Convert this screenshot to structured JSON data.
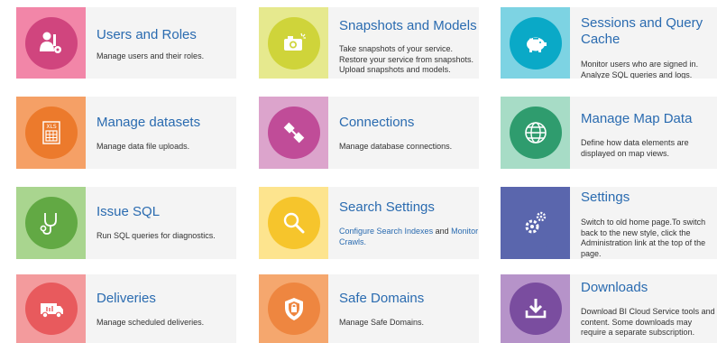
{
  "cards": [
    {
      "title": "Users and Roles",
      "desc": "Manage users and their roles.",
      "icon": "users-roles-icon",
      "tile": "#f286a8",
      "circle": "#d0457e"
    },
    {
      "title": "Snapshots and Models",
      "desc": "Take snapshots of your service. Restore your service from snapshots. Upload snapshots and models.",
      "icon": "camera-icon",
      "tile": "#e6e98e",
      "circle": "#cfd43a"
    },
    {
      "title": "Sessions and Query Cache",
      "desc": "Monitor users who are signed in. Analyze SQL queries and logs.",
      "icon": "piggy-bank-icon",
      "tile": "#7dd3e3",
      "circle": "#0aa9c7"
    },
    {
      "title": "Manage datasets",
      "desc": "Manage data file uploads.",
      "icon": "xls-file-icon",
      "tile": "#f5a066",
      "circle": "#ec7a2c"
    },
    {
      "title": "Connections",
      "desc": "Manage database connections.",
      "icon": "connection-plug-icon",
      "tile": "#dca4cc",
      "circle": "#c04c98"
    },
    {
      "title": "Manage Map Data",
      "desc": "Define how data elements are displayed on map views.",
      "icon": "globe-icon",
      "tile": "#a7dcc6",
      "circle": "#2f9c6e"
    },
    {
      "title": "Issue SQL",
      "desc": "Run SQL queries for diagnostics.",
      "icon": "stethoscope-icon",
      "tile": "#a9d58f",
      "circle": "#62a944"
    },
    {
      "title": "Search Settings",
      "desc": "",
      "icon": "search-magnifier-icon",
      "tile": "#fde48e",
      "circle": "#f6c52c"
    },
    {
      "title": "Settings",
      "desc": "Switch to old home page.To switch back to the new style, click the Administration link at the top of the page.",
      "icon": "gears-icon",
      "tile": "#5a66ad",
      "circle": "#5a66ad"
    },
    {
      "title": "Deliveries",
      "desc": "Manage scheduled deliveries.",
      "icon": "delivery-truck-icon",
      "tile": "#f39b9d",
      "circle": "#e85a5d"
    },
    {
      "title": "Safe Domains",
      "desc": "Manage Safe Domains.",
      "icon": "shield-icon",
      "tile": "#f5a76e",
      "circle": "#ee8640"
    },
    {
      "title": "Downloads",
      "desc": "Download BI Cloud Service tools and content. Some downloads may require a separate subscription.",
      "icon": "download-tray-icon",
      "tile": "#b693c9",
      "circle": "#7a4d9f"
    }
  ],
  "search_settings": {
    "link1": "Configure Search Indexes",
    "middle": " and ",
    "link2": "Monitor",
    "link2_tail": "Crawls."
  }
}
